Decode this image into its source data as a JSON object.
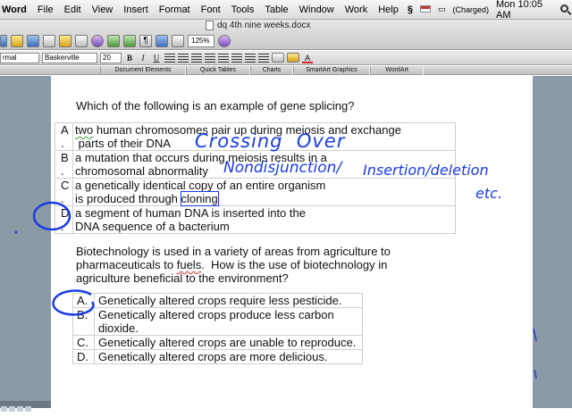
{
  "menubar": {
    "app": "Word",
    "items": [
      "File",
      "Edit",
      "View",
      "Insert",
      "Format",
      "Font",
      "Tools",
      "Table",
      "Window",
      "Work",
      "Help"
    ],
    "battery": "(Charged)",
    "clock": "Mon 10:05 AM"
  },
  "window": {
    "title": "dq 4th nine weeks.docx",
    "zoom": "125%"
  },
  "format": {
    "style": "rmal",
    "font": "Baskerville",
    "size": "20"
  },
  "gallery": {
    "tabs": [
      "Document Elements",
      "Quick Tables",
      "Charts",
      "SmartArt Graphics",
      "WordArt"
    ]
  },
  "q1": {
    "prompt": "Which of the following is an example of gene splicing?",
    "options": [
      {
        "letter": "A\n.",
        "line1a": "two",
        "line1b": " human chromosomes pair up during meiosis and exchange",
        "line2": " parts of their DNA"
      },
      {
        "letter": "B\n.",
        "line1": "a mutation that occurs during meiosis results in a",
        "line2": "chromosomal abnormality"
      },
      {
        "letter": "C\n.",
        "line1": "a genetically identical copy of an entire organism",
        "line2a": "is produced through ",
        "line2b": "cloning"
      },
      {
        "letter": "D\n.",
        "line1": "a segment of human DNA is inserted into the",
        "line2": "DNA sequence of a bacterium"
      }
    ]
  },
  "q2": {
    "prompt_a": "Biotechnology is used in a variety of areas from agriculture to",
    "prompt_b1": "pharmaceuticals to ",
    "prompt_b2": "fuels",
    "prompt_b3": ".  How is the use of biotechnology in",
    "prompt_c": "agriculture beneficial to the environment?",
    "options": [
      {
        "letter": "A.",
        "text": "Genetically altered crops require less pesticide."
      },
      {
        "letter": "B.",
        "text": "Genetically altered crops produce less carbon dioxide."
      },
      {
        "letter": "C.",
        "text": "Genetically altered crops are unable to reproduce."
      },
      {
        "letter": "D.",
        "text": "Genetically altered crops are more delicious."
      }
    ]
  },
  "annotations": {
    "crossing_over": "Crossing  Over",
    "nondisjunction": "Nondisjunction/",
    "insertion_deletion": "Insertion/deletion",
    "etc": "etc."
  },
  "colors": {
    "ink": "#1a3ce6",
    "pasteboard": "#8b9ba5"
  }
}
